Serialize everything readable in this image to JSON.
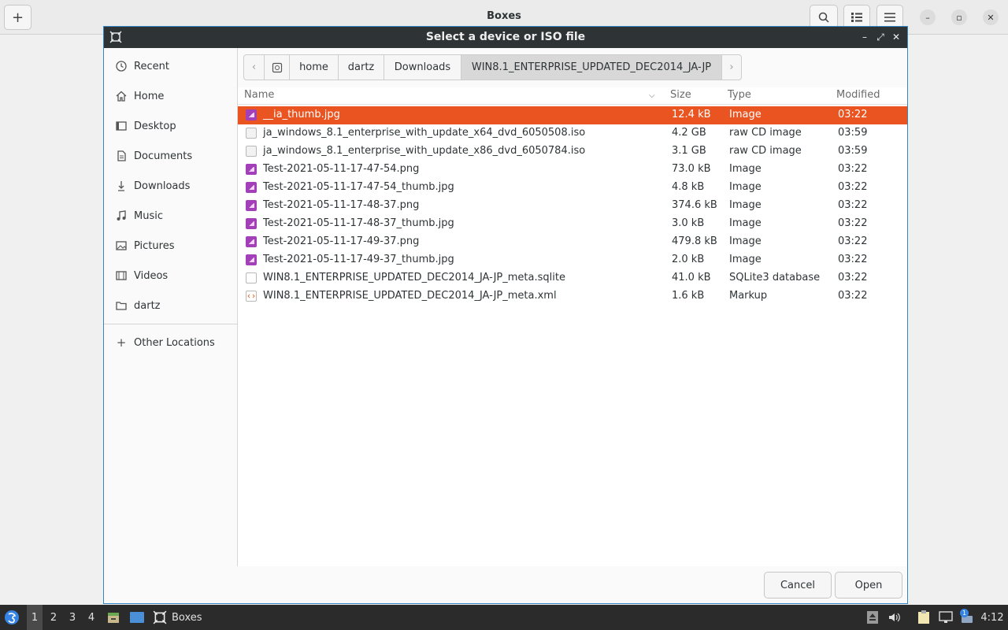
{
  "boxes": {
    "title": "Boxes",
    "new_button": "+",
    "window_controls": [
      "minimize",
      "restore",
      "close"
    ]
  },
  "dialog": {
    "title": "Select a device or ISO file",
    "sidebar": [
      {
        "icon": "clock-icon",
        "label": "Recent"
      },
      {
        "icon": "home-icon",
        "label": "Home"
      },
      {
        "icon": "desktop-icon",
        "label": "Desktop"
      },
      {
        "icon": "document-icon",
        "label": "Documents"
      },
      {
        "icon": "download-icon",
        "label": "Downloads"
      },
      {
        "icon": "music-icon",
        "label": "Music"
      },
      {
        "icon": "picture-icon",
        "label": "Pictures"
      },
      {
        "icon": "video-icon",
        "label": "Videos"
      },
      {
        "icon": "folder-icon",
        "label": "dartz"
      }
    ],
    "other_locations": "Other Locations",
    "path": [
      "home",
      "dartz",
      "Downloads",
      "WIN8.1_ENTERPRISE_UPDATED_DEC2014_JA-JP"
    ],
    "columns": {
      "name": "Name",
      "size": "Size",
      "type": "Type",
      "modified": "Modified"
    },
    "files": [
      {
        "name": "__ia_thumb.jpg",
        "size": "12.4 kB",
        "type": "Image",
        "modified": "03:22",
        "icon": "image-file-icon"
      },
      {
        "name": "ja_windows_8.1_enterprise_with_update_x64_dvd_6050508.iso",
        "size": "4.2 GB",
        "type": "raw CD image",
        "modified": "03:59",
        "icon": "disc-image-icon"
      },
      {
        "name": "ja_windows_8.1_enterprise_with_update_x86_dvd_6050784.iso",
        "size": "3.1 GB",
        "type": "raw CD image",
        "modified": "03:59",
        "icon": "disc-image-icon"
      },
      {
        "name": "Test-2021-05-11-17-47-54.png",
        "size": "73.0 kB",
        "type": "Image",
        "modified": "03:22",
        "icon": "image-file-icon"
      },
      {
        "name": "Test-2021-05-11-17-47-54_thumb.jpg",
        "size": "4.8 kB",
        "type": "Image",
        "modified": "03:22",
        "icon": "image-file-icon"
      },
      {
        "name": "Test-2021-05-11-17-48-37.png",
        "size": "374.6 kB",
        "type": "Image",
        "modified": "03:22",
        "icon": "image-file-icon"
      },
      {
        "name": "Test-2021-05-11-17-48-37_thumb.jpg",
        "size": "3.0 kB",
        "type": "Image",
        "modified": "03:22",
        "icon": "image-file-icon"
      },
      {
        "name": "Test-2021-05-11-17-49-37.png",
        "size": "479.8 kB",
        "type": "Image",
        "modified": "03:22",
        "icon": "image-file-icon"
      },
      {
        "name": "Test-2021-05-11-17-49-37_thumb.jpg",
        "size": "2.0 kB",
        "type": "Image",
        "modified": "03:22",
        "icon": "image-file-icon"
      },
      {
        "name": "WIN8.1_ENTERPRISE_UPDATED_DEC2014_JA-JP_meta.sqlite",
        "size": "41.0 kB",
        "type": "SQLite3 database",
        "modified": "03:22",
        "icon": "generic-file-icon"
      },
      {
        "name": "WIN8.1_ENTERPRISE_UPDATED_DEC2014_JA-JP_meta.xml",
        "size": "1.6 kB",
        "type": "Markup",
        "modified": "03:22",
        "icon": "markup-file-icon"
      }
    ],
    "selected_index": 0,
    "cancel_label": "Cancel",
    "open_label": "Open"
  },
  "taskbar": {
    "workspaces": [
      "1",
      "2",
      "3",
      "4"
    ],
    "active_workspace": "1",
    "task_label": "Boxes",
    "clock": "4:12",
    "notification_count": "1"
  },
  "colors": {
    "selection": "#e95420",
    "dialog_titlebar": "#2e3436",
    "taskbar": "#2b2b2b",
    "image_icon": "#a33fb9"
  }
}
